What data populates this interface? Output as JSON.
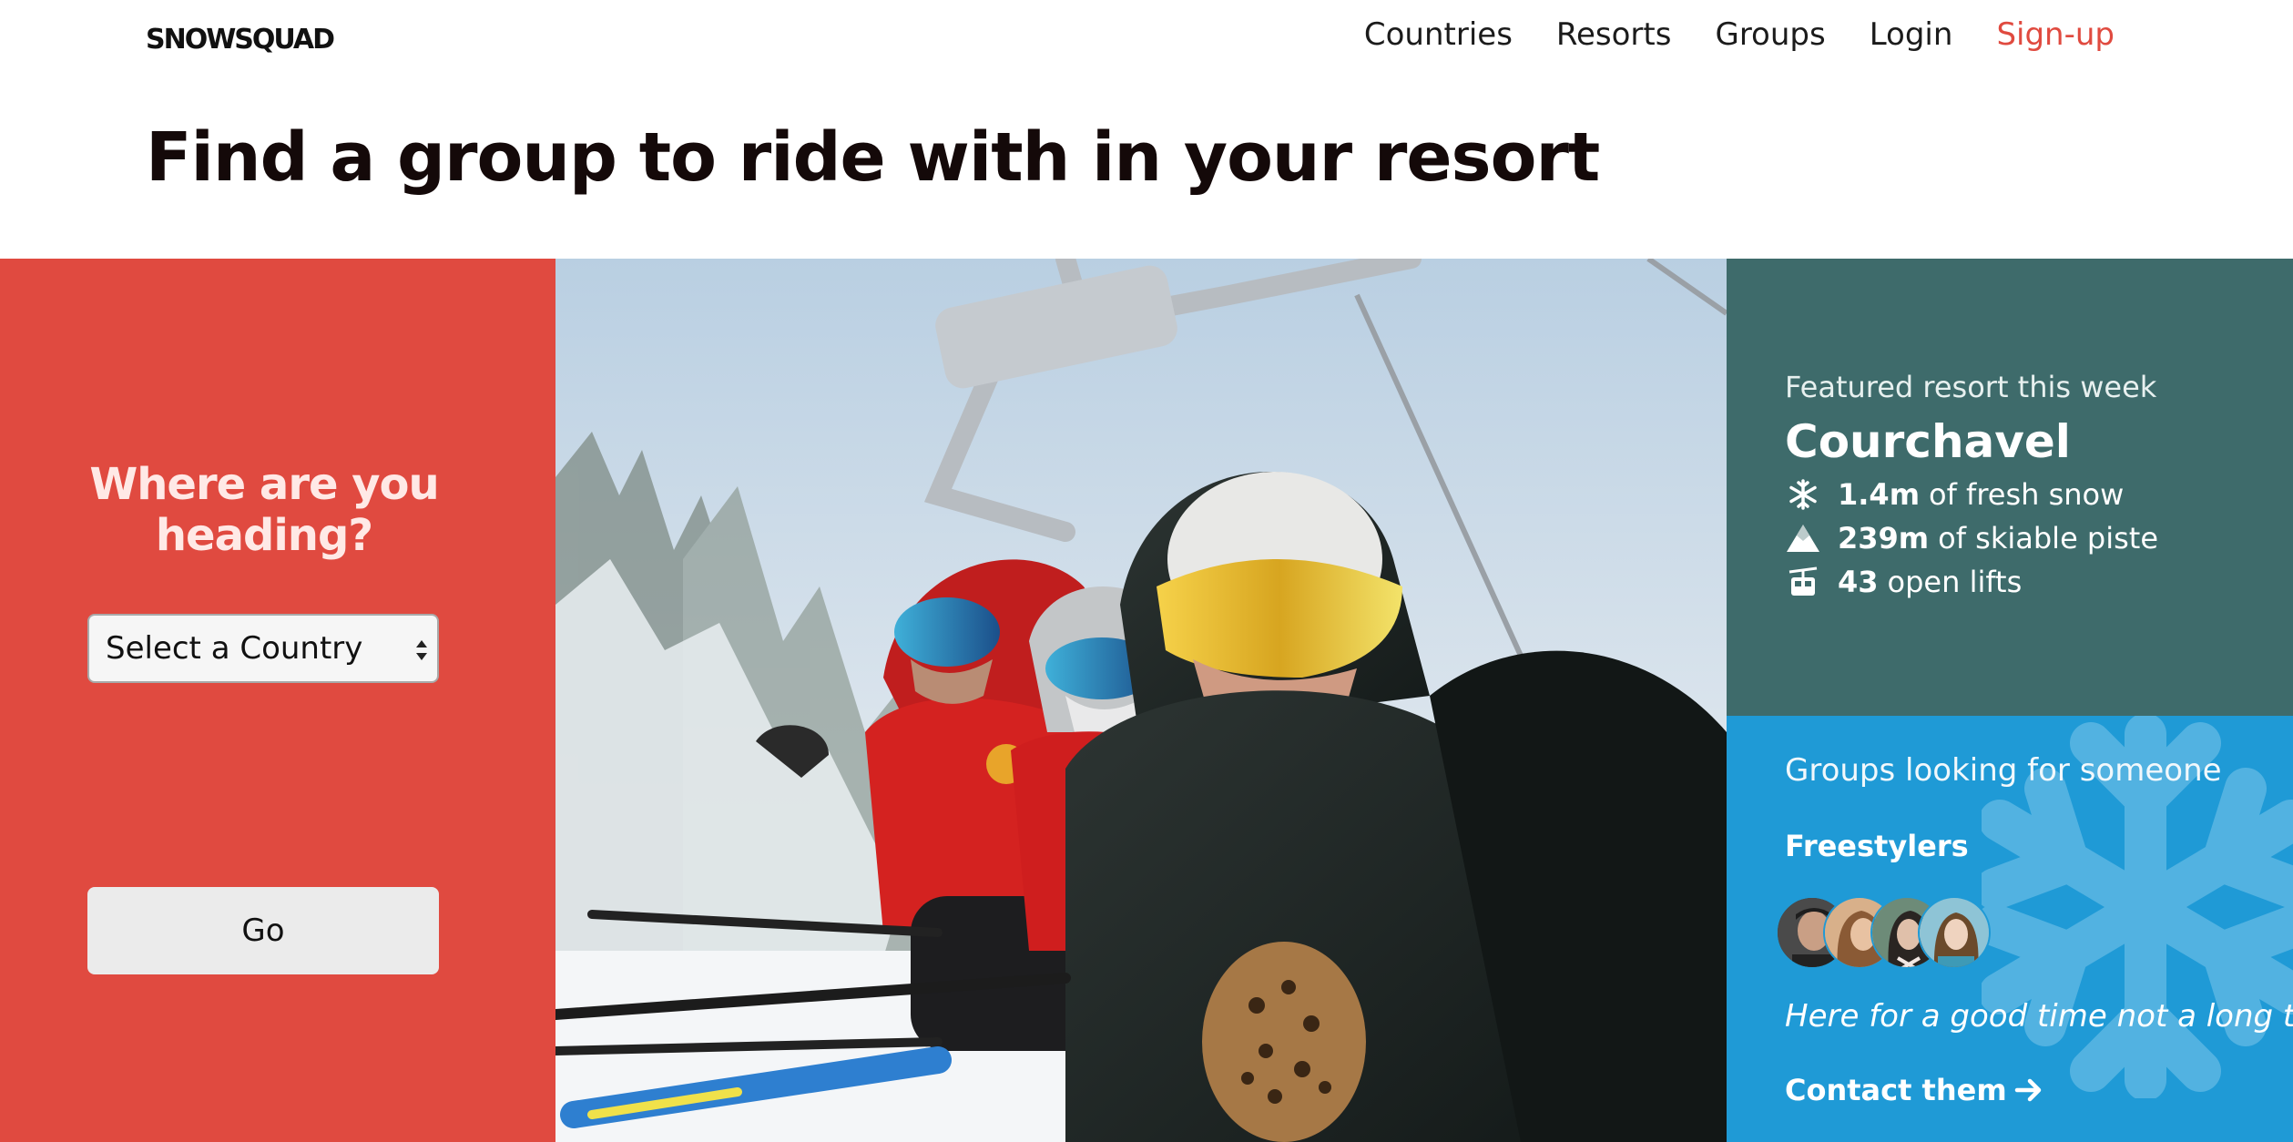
{
  "brand": {
    "logo": "SNOWSQUAD"
  },
  "nav": {
    "items": [
      {
        "label": "Countries"
      },
      {
        "label": "Resorts"
      },
      {
        "label": "Groups"
      },
      {
        "label": "Login"
      },
      {
        "label": "Sign-up"
      }
    ]
  },
  "page": {
    "title": "Find a group to ride with in your resort"
  },
  "search": {
    "heading": "Where are you heading?",
    "country_select_value": "Select a Country",
    "go_label": "Go"
  },
  "hero_image": {
    "alt": "friends-on-chairlift-photo"
  },
  "featured": {
    "kicker": "Featured resort this week",
    "resort_name": "Courchavel",
    "stats": [
      {
        "icon": "snowflake-icon",
        "value": "1.4m",
        "text": "of fresh snow"
      },
      {
        "icon": "mountain-icon",
        "value": "239m",
        "text": "of skiable piste"
      },
      {
        "icon": "cable-car-icon",
        "value": "43",
        "text": "open lifts"
      }
    ]
  },
  "groups": {
    "title": "Groups looking for someone",
    "group_name": "Freestylers",
    "avatar_count": 4,
    "tagline": "Here for a good time not a long time",
    "contact_label": "Contact them"
  },
  "colors": {
    "accent_red": "#e04a40",
    "teal": "#3e6b6b",
    "blue": "#1f9ad6",
    "signup": "#e04a3f"
  }
}
